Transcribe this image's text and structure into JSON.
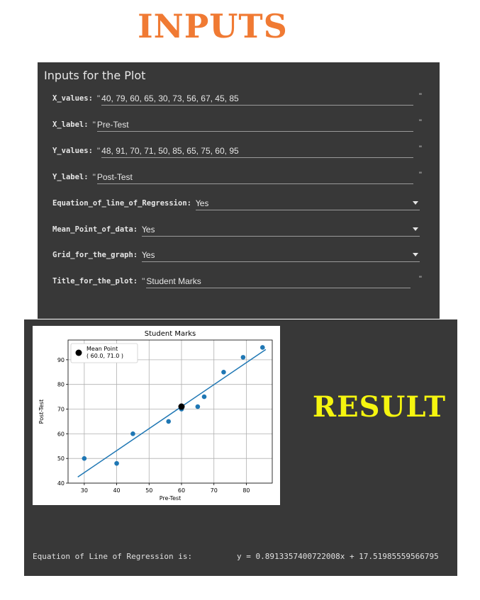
{
  "heading_inputs": "INPUTS",
  "heading_result": "RESULT",
  "form": {
    "title": "Inputs for the Plot",
    "x_values": {
      "label": "X_values:",
      "value": "40, 79, 60, 65, 30, 73, 56, 67, 45, 85"
    },
    "x_label": {
      "label": "X_label:",
      "value": "Pre-Test"
    },
    "y_values": {
      "label": "Y_values:",
      "value": "48, 91, 70, 71, 50, 85, 65, 75, 60, 95"
    },
    "y_label": {
      "label": "Y_label:",
      "value": "Post-Test"
    },
    "equation_line": {
      "label": "Equation_of_line_of_Regression:",
      "value": "Yes"
    },
    "mean_point": {
      "label": "Mean_Point_of_data:",
      "value": "Yes"
    },
    "grid": {
      "label": "Grid_for_the_graph:",
      "value": "Yes"
    },
    "title_plot": {
      "label": "Title_for_the_plot:",
      "value": "Student Marks"
    },
    "open_quote": "\"",
    "close_quote": "\""
  },
  "result": {
    "equation_label": "Equation of Line of Regression is:",
    "equation_value": "y = 0.8913357400722008x + 17.51985559566795"
  },
  "chart_data": {
    "type": "scatter",
    "title": "Student Marks",
    "xlabel": "Pre-Test",
    "ylabel": "Post-Test",
    "x": [
      40,
      79,
      60,
      65,
      30,
      73,
      56,
      67,
      45,
      85
    ],
    "y": [
      48,
      91,
      70,
      71,
      50,
      85,
      65,
      75,
      60,
      95
    ],
    "xlim": [
      25,
      88
    ],
    "ylim": [
      40,
      98
    ],
    "x_ticks": [
      30,
      40,
      50,
      60,
      70,
      80
    ],
    "y_ticks": [
      40,
      50,
      60,
      70,
      80,
      90
    ],
    "grid": true,
    "regression": {
      "slope": 0.8913357400722008,
      "intercept": 17.51985559566795,
      "x_range": [
        28,
        86
      ]
    },
    "mean_point": {
      "x": 60.0,
      "y": 71.0
    },
    "legend": {
      "title": "Mean Point",
      "text": "( 60.0, 71.0 )",
      "placement": "top-left"
    },
    "point_color": "#1f77b4",
    "line_color": "#1f77b4",
    "mean_color": "#000000"
  }
}
